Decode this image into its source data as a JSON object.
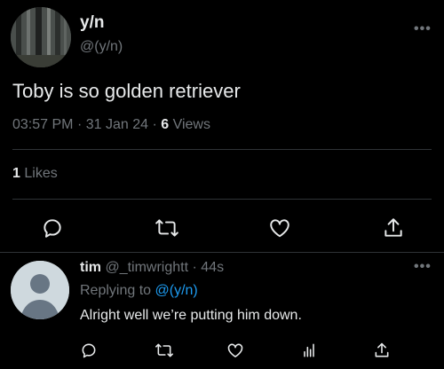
{
  "tweet": {
    "author_name": "y/n",
    "author_handle": "@(y/n)",
    "text": "Toby is so golden retriever",
    "time": "03:57 PM",
    "sep1": "·",
    "date": "31 Jan 24",
    "sep2": "·",
    "views_count": "6",
    "views_label": "Views",
    "likes_count": "1",
    "likes_label": "Likes",
    "more_glyph": "•••"
  },
  "reply": {
    "name": "tim",
    "handle": "@_timwrightt",
    "sep": "·",
    "age": "44s",
    "replying_prefix": "Replying to",
    "replying_to": "@(y/n)",
    "text": "Alright well we’re putting him down.",
    "more_glyph": "•••"
  },
  "colors": {
    "background": "#000000",
    "text_primary": "#e7e9ea",
    "text_secondary": "#71767b",
    "accent": "#1d9bf0",
    "divider": "#2f3336"
  },
  "icons": {
    "tweet_actions": [
      "reply-icon",
      "retweet-icon",
      "like-icon",
      "share-icon"
    ],
    "reply_actions": [
      "reply-icon",
      "retweet-icon",
      "like-icon",
      "views-icon",
      "share-icon"
    ]
  }
}
